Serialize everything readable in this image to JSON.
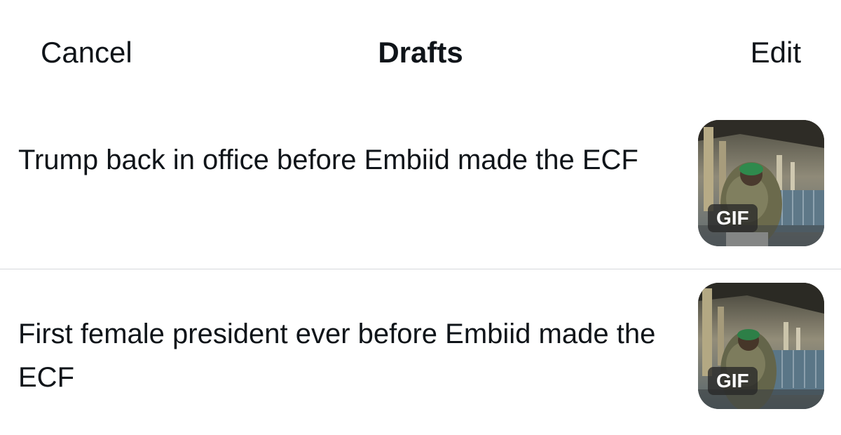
{
  "nav": {
    "cancel_label": "Cancel",
    "title": "Drafts",
    "edit_label": "Edit"
  },
  "drafts": [
    {
      "text": "Trump back in office before Embiid made the ECF",
      "media_badge": "GIF"
    },
    {
      "text": "First female president ever before Embiid made the ECF",
      "media_badge": "GIF"
    }
  ],
  "colors": {
    "text": "#0f1419",
    "divider": "#d6d9dc",
    "badge_bg": "#282828",
    "badge_text": "#ffffff"
  }
}
